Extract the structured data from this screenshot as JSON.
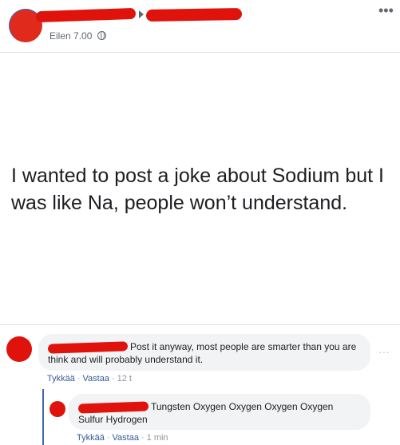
{
  "post": {
    "timestamp": "Eilen 7.00",
    "text": "I wanted to post a joke about Sodium but I was like Na, people won’t understand.",
    "more_icon": "more-horizontal-icon",
    "audience_icon": "globe-icon"
  },
  "comments": [
    {
      "text": "Post it anyway, most people are smarter than you are think and will probably understand it.",
      "like_label": "Tykkää",
      "reply_label": "Vastaa",
      "time": "12 t"
    },
    {
      "text": "Tungsten Oxygen Oxygen Oxygen Oxygen Sulfur Hydrogen",
      "like_label": "Tykkää",
      "reply_label": "Vastaa",
      "time": "1 min"
    }
  ],
  "colors": {
    "redaction": "#e0120c",
    "link": "#385898",
    "bubble": "#f2f3f5",
    "reply_line": "#4267b2"
  }
}
